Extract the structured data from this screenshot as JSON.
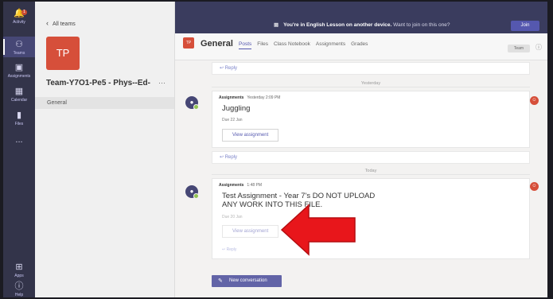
{
  "colors": {
    "rail": "#33344a",
    "brand_purple": "#5558af",
    "team_avatar": "#d64f3a",
    "arrow_red": "#e8161b",
    "online_green": "#92c353"
  },
  "rail": {
    "items": [
      {
        "label": "Activity",
        "icon": "bell-icon",
        "badge": "1"
      },
      {
        "label": "Teams",
        "icon": "teams-icon"
      },
      {
        "label": "Assignments",
        "icon": "assignments-icon"
      },
      {
        "label": "Calendar",
        "icon": "calendar-icon"
      },
      {
        "label": "Files",
        "icon": "files-icon"
      },
      {
        "label": "...",
        "icon": "more-icon"
      },
      {
        "label": "Apps",
        "icon": "apps-icon"
      },
      {
        "label": "Help",
        "icon": "help-icon"
      }
    ]
  },
  "sidebar": {
    "back_label": "All teams",
    "avatar_text": "TP",
    "team_name": "Team-Y7O1-Pe5 - Phys--Ed-",
    "more": "···",
    "channel": "General"
  },
  "topbar": {
    "message_bold": "You're in English Lesson on another device.",
    "message_rest": "Want to join on this one?",
    "join_label": "Join"
  },
  "channel_header": {
    "avatar_text": "TP",
    "title": "General",
    "tabs": [
      "Posts",
      "Files",
      "Class Notebook",
      "Assignments",
      "Grades"
    ],
    "active_tab": "Posts",
    "team_pill": "Team"
  },
  "feed": {
    "reply_label": "Reply",
    "day_yesterday": "Yesterday",
    "day_today": "Today",
    "posts": [
      {
        "author": "Assignments",
        "time": "Yesterday 2:09 PM",
        "title": "Juggling",
        "due": "Due 22 Jan",
        "button": "View assignment"
      },
      {
        "author": "Assignments",
        "time": "1:48 PM",
        "title": "Test Assignment - Year 7's DO NOT UPLOAD ANY WORK INTO THIS FILE.",
        "due": "Due 20 Jan",
        "button": "View assignment"
      }
    ],
    "new_conversation": "New conversation"
  }
}
